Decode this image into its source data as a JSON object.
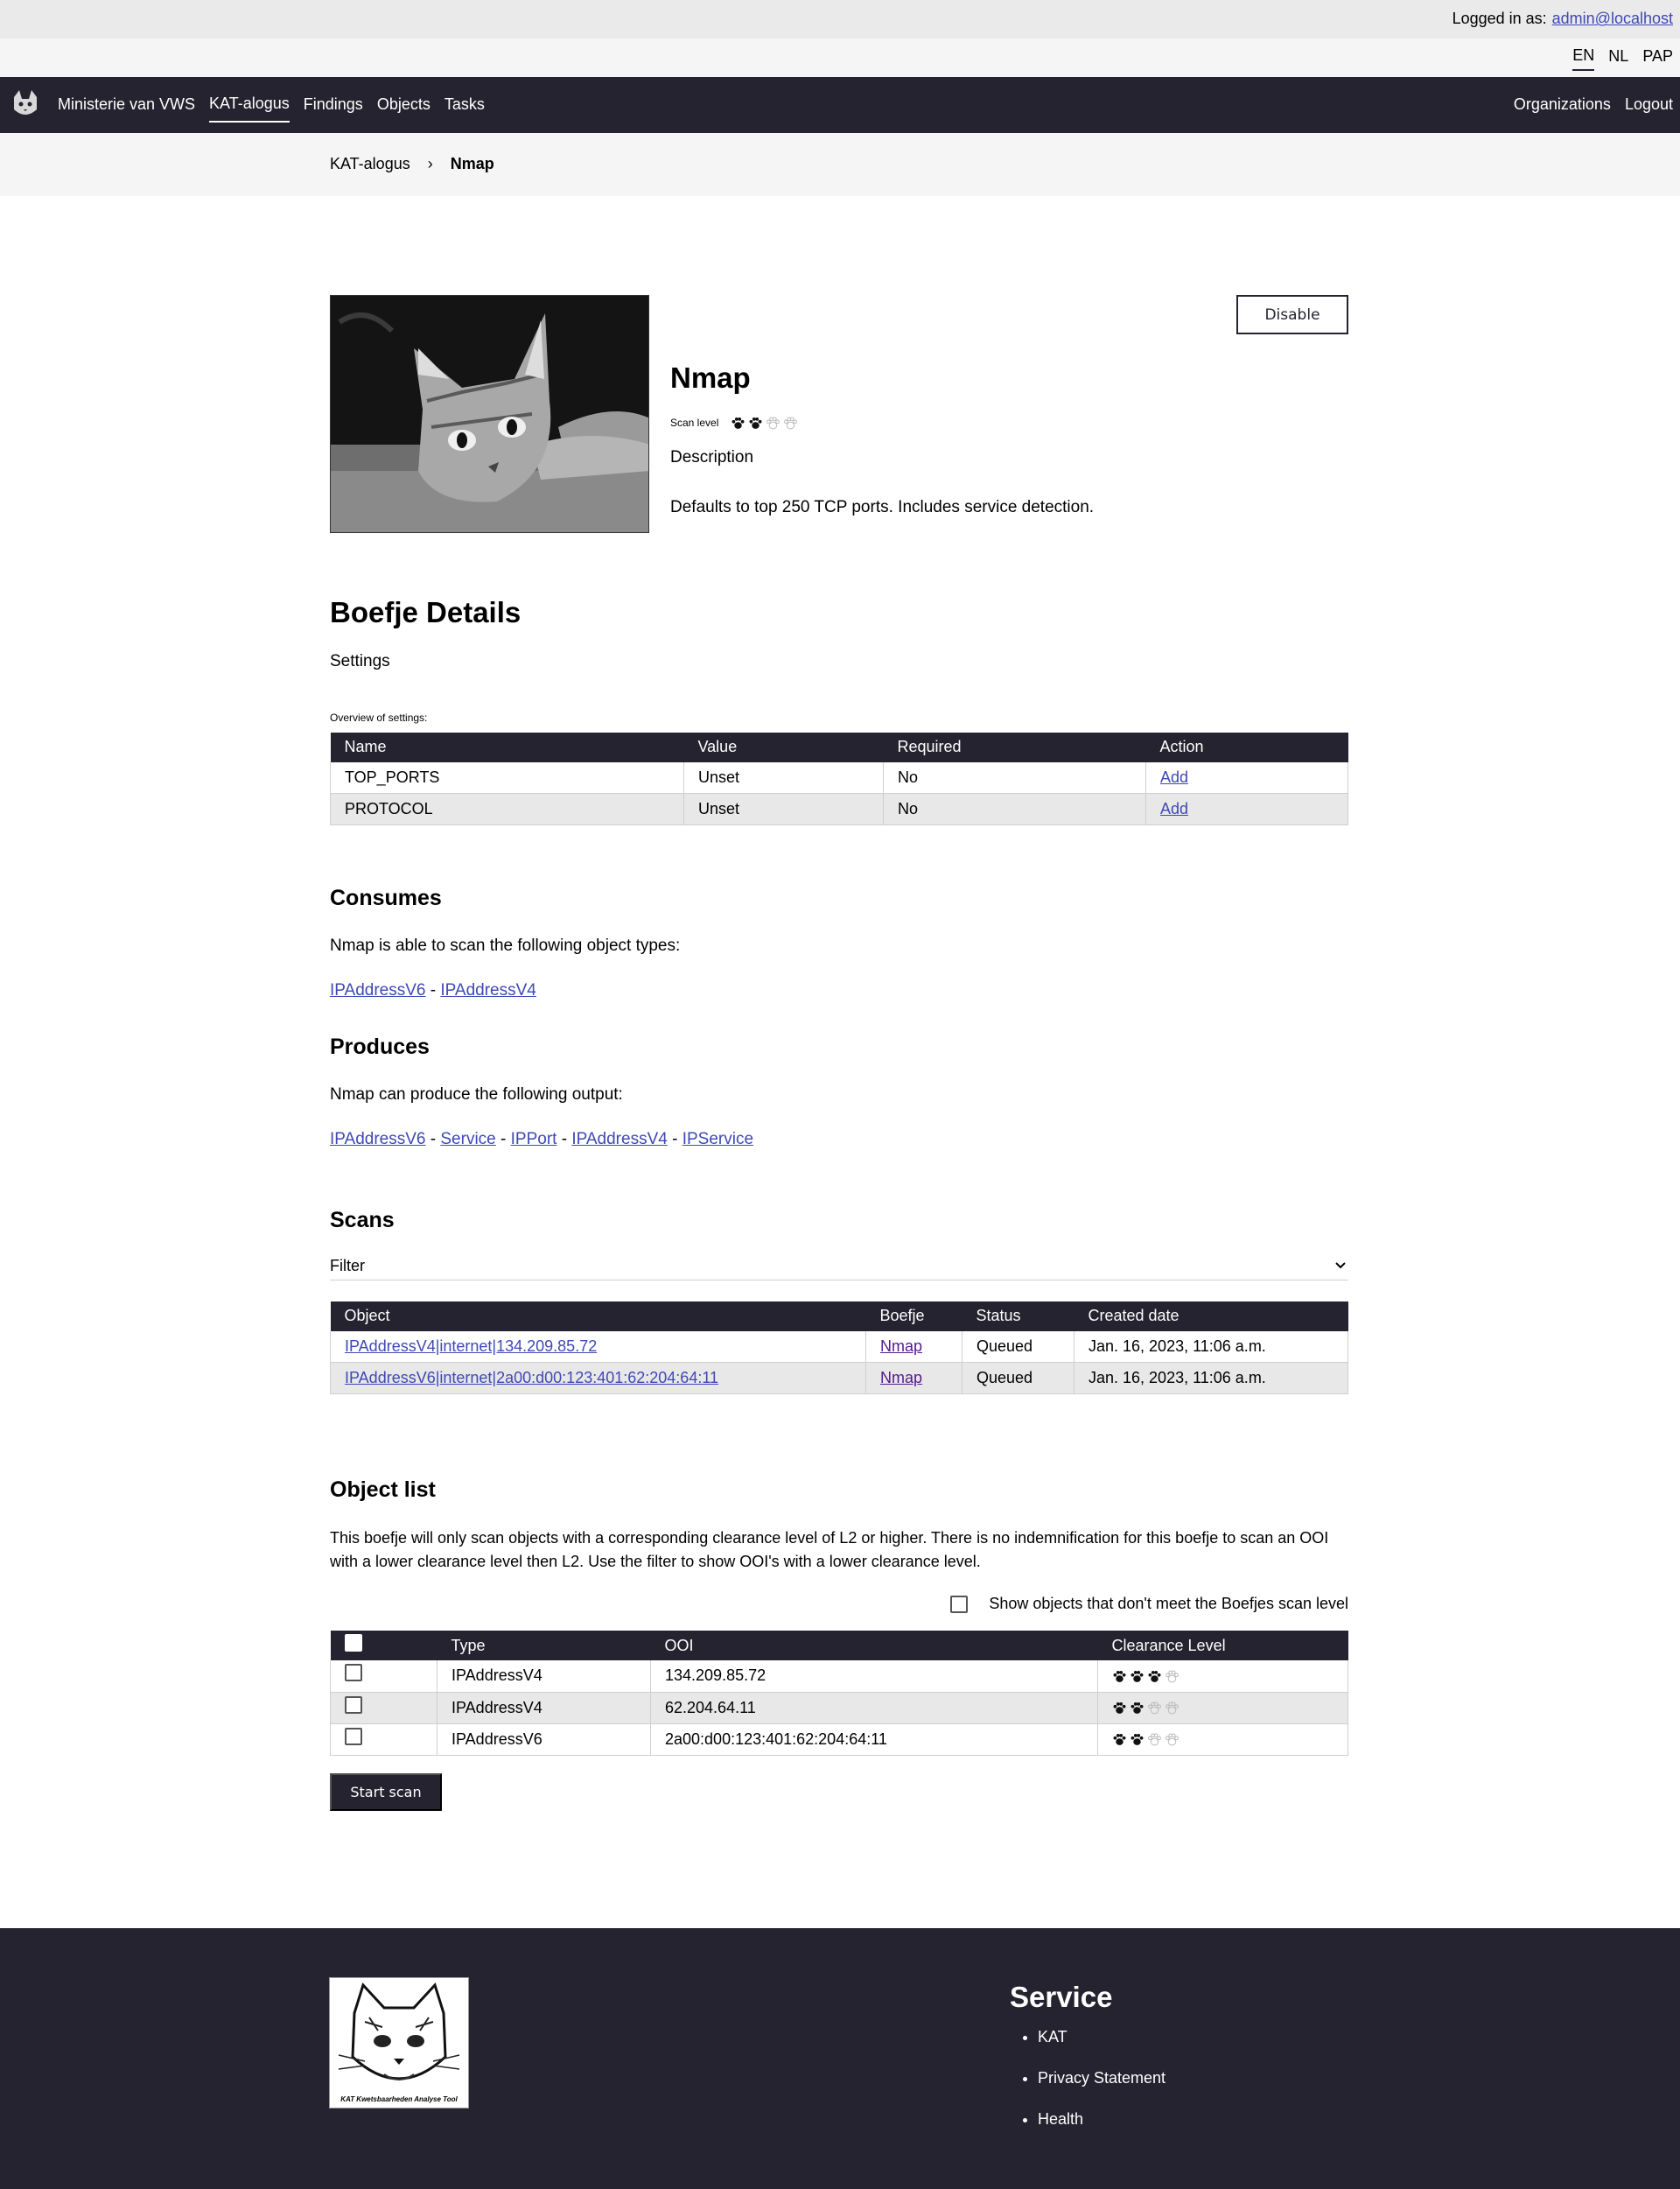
{
  "userbar": {
    "label": "Logged in as:",
    "user": "admin@localhost"
  },
  "languages": [
    "EN",
    "NL",
    "PAP"
  ],
  "nav": {
    "org": "Ministerie van VWS",
    "items": [
      "KAT-alogus",
      "Findings",
      "Objects",
      "Tasks"
    ],
    "right": [
      "Organizations",
      "Logout"
    ]
  },
  "breadcrumb": {
    "parent": "KAT-alogus",
    "current": "Nmap"
  },
  "boefje": {
    "name": "Nmap",
    "scan_level_label": "Scan level",
    "scan_level": 2,
    "description_label": "Description",
    "description": "Defaults to top 250 TCP ports. Includes service detection.",
    "disable_label": "Disable"
  },
  "details": {
    "title": "Boefje Details",
    "settings_label": "Settings",
    "overview_caption": "Overview of settings:",
    "columns": [
      "Name",
      "Value",
      "Required",
      "Action"
    ],
    "rows": [
      {
        "name": "TOP_PORTS",
        "value": "Unset",
        "required": "No",
        "action": "Add"
      },
      {
        "name": "PROTOCOL",
        "value": "Unset",
        "required": "No",
        "action": "Add"
      }
    ]
  },
  "consumes": {
    "title": "Consumes",
    "text": "Nmap is able to scan the following object types:",
    "types": [
      "IPAddressV6",
      "IPAddressV4"
    ]
  },
  "produces": {
    "title": "Produces",
    "text": "Nmap can produce the following output:",
    "types": [
      "IPAddressV6",
      "Service",
      "IPPort",
      "IPAddressV4",
      "IPService"
    ]
  },
  "scans": {
    "title": "Scans",
    "filter_label": "Filter",
    "columns": [
      "Object",
      "Boefje",
      "Status",
      "Created date"
    ],
    "rows": [
      {
        "object": "IPAddressV4|internet|134.209.85.72",
        "boefje": "Nmap",
        "status": "Queued",
        "created": "Jan. 16, 2023, 11:06 a.m."
      },
      {
        "object": "IPAddressV6|internet|2a00:d00:123:401:62:204:64:11",
        "boefje": "Nmap",
        "status": "Queued",
        "created": "Jan. 16, 2023, 11:06 a.m."
      }
    ]
  },
  "objects": {
    "title": "Object list",
    "info": "This boefje will only scan objects with a corresponding clearance level of L2 or higher. There is no indemnification for this boefje to scan an OOI with a lower clearance level then L2. Use the filter to show OOI's with a lower clearance level.",
    "show_label": "Show objects that don't meet the Boefjes scan level",
    "columns": [
      "Type",
      "OOI",
      "Clearance Level"
    ],
    "rows": [
      {
        "type": "IPAddressV4",
        "ooi": "134.209.85.72",
        "level": 3
      },
      {
        "type": "IPAddressV4",
        "ooi": "62.204.64.11",
        "level": 2
      },
      {
        "type": "IPAddressV6",
        "ooi": "2a00:d00:123:401:62:204:64:11",
        "level": 2
      }
    ],
    "start_label": "Start scan"
  },
  "footer": {
    "logo_text": "KAT Kwetsbaarheden Analyse Tool",
    "service_title": "Service",
    "links": [
      "KAT",
      "Privacy Statement",
      "Health"
    ]
  },
  "colors": {
    "dark": "#24232f",
    "link": "#3f48b5",
    "visited": "#551a8b"
  }
}
